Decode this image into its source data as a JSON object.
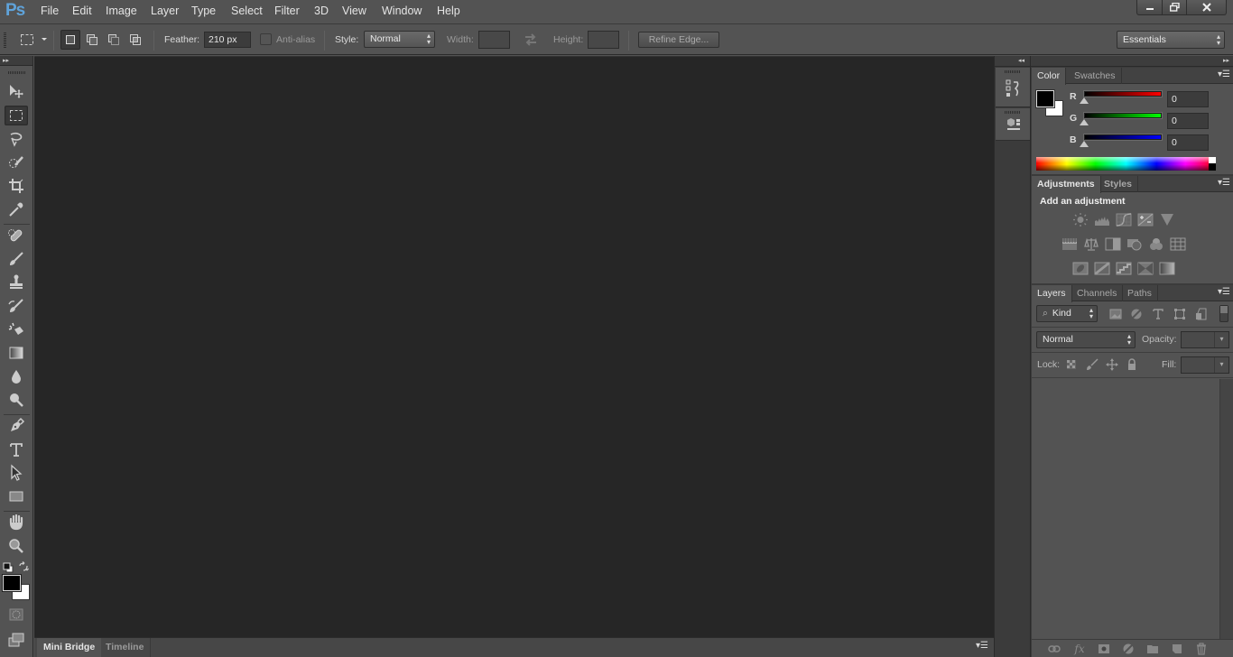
{
  "app": {
    "logo": "Ps",
    "name": "Adobe Photoshop"
  },
  "menubar": {
    "items": [
      "File",
      "Edit",
      "Image",
      "Layer",
      "Type",
      "Select",
      "Filter",
      "3D",
      "View",
      "Window",
      "Help"
    ]
  },
  "window_controls": {
    "minimize": "minimize-icon",
    "restore": "restore-icon",
    "close": "close-icon"
  },
  "options_bar": {
    "tool_preset_icon": "rectangular-marquee-icon",
    "selection_modes": [
      "new-selection",
      "add-to-selection",
      "subtract-from-selection",
      "intersect-with-selection"
    ],
    "active_selection_mode": "new-selection",
    "feather_label": "Feather:",
    "feather_value": "210 px",
    "anti_alias_label": "Anti-alias",
    "anti_alias_checked": false,
    "style_label": "Style:",
    "style_value": "Normal",
    "width_label": "Width:",
    "width_value": "",
    "swap_icon": "swap-arrows-icon",
    "height_label": "Height:",
    "height_value": "",
    "refine_edge_label": "Refine Edge...",
    "workspace_value": "Essentials"
  },
  "toolbar": {
    "tools": [
      {
        "name": "move-tool",
        "icon": "move-icon"
      },
      {
        "name": "rectangular-marquee-tool",
        "icon": "marquee-icon",
        "active": true
      },
      {
        "name": "lasso-tool",
        "icon": "lasso-icon"
      },
      {
        "name": "quick-selection-tool",
        "icon": "quick-selection-icon"
      },
      {
        "name": "crop-tool",
        "icon": "crop-icon"
      },
      {
        "name": "eyedropper-tool",
        "icon": "eyedropper-icon"
      },
      {
        "name": "spot-healing-brush-tool",
        "icon": "bandage-icon"
      },
      {
        "name": "brush-tool",
        "icon": "brush-icon"
      },
      {
        "name": "clone-stamp-tool",
        "icon": "stamp-icon"
      },
      {
        "name": "history-brush-tool",
        "icon": "history-brush-icon"
      },
      {
        "name": "eraser-tool",
        "icon": "eraser-icon"
      },
      {
        "name": "gradient-tool",
        "icon": "gradient-icon"
      },
      {
        "name": "blur-tool",
        "icon": "drop-icon"
      },
      {
        "name": "dodge-tool",
        "icon": "dodge-icon"
      },
      {
        "name": "pen-tool",
        "icon": "pen-icon"
      },
      {
        "name": "type-tool",
        "icon": "type-icon"
      },
      {
        "name": "path-selection-tool",
        "icon": "arrow-icon"
      },
      {
        "name": "rectangle-tool",
        "icon": "rectangle-icon"
      },
      {
        "name": "hand-tool",
        "icon": "hand-icon"
      },
      {
        "name": "zoom-tool",
        "icon": "magnifier-icon"
      }
    ],
    "foreground_color": "#000000",
    "background_color": "#ffffff"
  },
  "bottom_panel": {
    "tabs": [
      {
        "label": "Mini Bridge",
        "active": true
      },
      {
        "label": "Timeline",
        "active": false
      }
    ]
  },
  "color_panel": {
    "tabs": [
      {
        "label": "Color",
        "active": true
      },
      {
        "label": "Swatches",
        "active": false
      }
    ],
    "foreground": "#000000",
    "background": "#ffffff",
    "channels": [
      {
        "label": "R",
        "value": "0",
        "color": "#ff0000"
      },
      {
        "label": "G",
        "value": "0",
        "color": "#00ff00"
      },
      {
        "label": "B",
        "value": "0",
        "color": "#0000ff"
      }
    ]
  },
  "adjustments_panel": {
    "tabs": [
      {
        "label": "Adjustments",
        "active": true
      },
      {
        "label": "Styles",
        "active": false
      }
    ],
    "heading": "Add an adjustment",
    "rows": [
      [
        "brightness-contrast-icon",
        "levels-icon",
        "curves-icon",
        "exposure-icon",
        "vibrance-icon"
      ],
      [
        "hue-saturation-icon",
        "color-balance-icon",
        "black-white-icon",
        "photo-filter-icon",
        "channel-mixer-icon",
        "color-lookup-icon"
      ],
      [
        "invert-icon",
        "posterize-icon",
        "threshold-icon",
        "selective-color-icon",
        "gradient-map-icon"
      ]
    ]
  },
  "layers_panel": {
    "tabs": [
      {
        "label": "Layers",
        "active": true
      },
      {
        "label": "Channels",
        "active": false
      },
      {
        "label": "Paths",
        "active": false
      }
    ],
    "filter_kind": "Kind",
    "blend_mode": "Normal",
    "opacity_label": "Opacity:",
    "opacity_value": "",
    "lock_label": "Lock:",
    "fill_label": "Fill:",
    "fill_value": "",
    "footer_icons": [
      "link-layers-icon",
      "fx-icon",
      "layer-mask-icon",
      "adjustment-layer-icon",
      "group-folder-icon",
      "new-layer-icon",
      "trash-icon"
    ]
  }
}
